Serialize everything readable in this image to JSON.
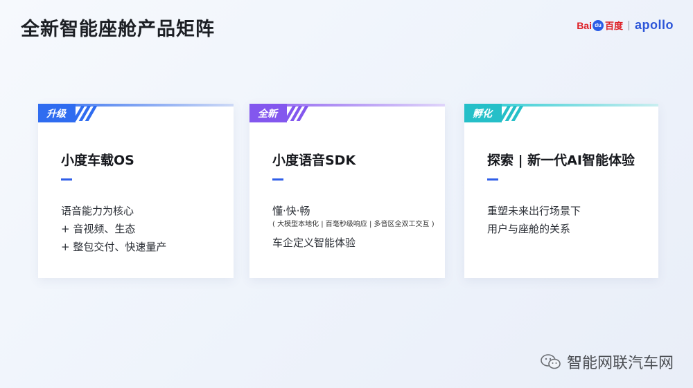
{
  "header": {
    "title": "全新智能座舱产品矩阵",
    "logo_baidu_prefix": "Bai",
    "logo_baidu_paw": "du",
    "logo_baidu_cn": "百度",
    "logo_apollo": "apollo"
  },
  "cards": [
    {
      "tag": "升级",
      "title": "小度车载OS",
      "lines": [
        "语音能力为核心",
        "+ 音视频、生态",
        "+ 整包交付、快速量产"
      ]
    },
    {
      "tag": "全新",
      "title": "小度语音SDK",
      "line1": "懂·快·畅",
      "small": "( 大模型本地化 | 百毫秒级响应 | 多音区全双工交互 )",
      "line2": "车企定义智能体验"
    },
    {
      "tag": "孵化",
      "title": "探索 | 新一代AI智能体验",
      "lines": [
        "重塑未来出行场景下",
        "用户与座舱的关系"
      ]
    }
  ],
  "watermark": {
    "text": "智能网联汽车网",
    "icon": "wechat-icon"
  },
  "colors": {
    "blue": "#2f6cf0",
    "purple": "#8357ee",
    "teal": "#25bfc8",
    "dash": "#2f5ee8"
  }
}
